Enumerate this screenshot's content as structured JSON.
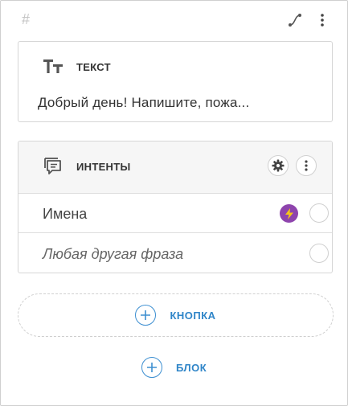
{
  "header": {
    "hash_symbol": "#",
    "connect_icon": "connector-icon",
    "menu_icon": "more-vert-icon"
  },
  "text_card": {
    "icon": "text-format-icon",
    "title": "ТЕКСТ",
    "body": "Добрый день! Напишите, пожа..."
  },
  "intents_card": {
    "icon": "chat-message-icon",
    "title": "ИНТЕНТЫ",
    "settings_icon": "gear-icon",
    "menu_icon": "more-vert-icon",
    "items": [
      {
        "label": "Имена",
        "has_bolt": true,
        "bolt_color": "#8e44ad"
      },
      {
        "label": "Любая другая фраза",
        "has_bolt": false
      }
    ]
  },
  "actions": {
    "add_button_label": "КНОПКА",
    "add_block_label": "БЛОК",
    "accent_color": "#2f85c8"
  }
}
